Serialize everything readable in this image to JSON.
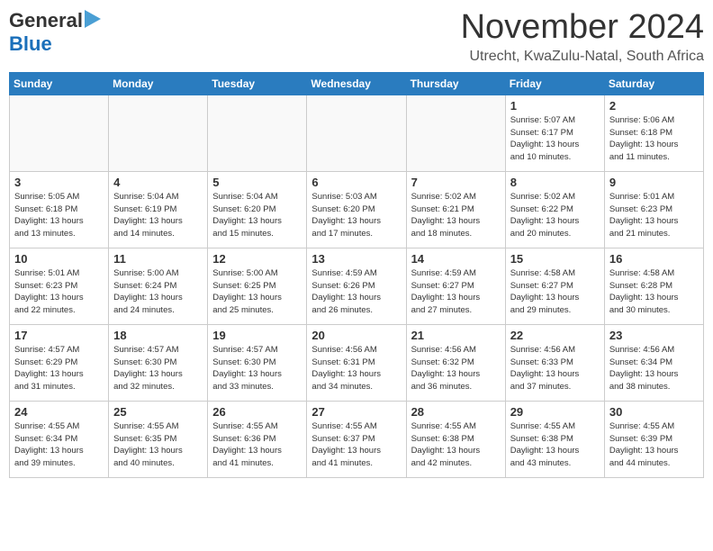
{
  "header": {
    "logo_general": "General",
    "logo_blue": "Blue",
    "month_title": "November 2024",
    "location": "Utrecht, KwaZulu-Natal, South Africa"
  },
  "days_of_week": [
    "Sunday",
    "Monday",
    "Tuesday",
    "Wednesday",
    "Thursday",
    "Friday",
    "Saturday"
  ],
  "weeks": [
    [
      {
        "day": "",
        "info": "",
        "empty": true
      },
      {
        "day": "",
        "info": "",
        "empty": true
      },
      {
        "day": "",
        "info": "",
        "empty": true
      },
      {
        "day": "",
        "info": "",
        "empty": true
      },
      {
        "day": "",
        "info": "",
        "empty": true
      },
      {
        "day": "1",
        "info": "Sunrise: 5:07 AM\nSunset: 6:17 PM\nDaylight: 13 hours\nand 10 minutes."
      },
      {
        "day": "2",
        "info": "Sunrise: 5:06 AM\nSunset: 6:18 PM\nDaylight: 13 hours\nand 11 minutes."
      }
    ],
    [
      {
        "day": "3",
        "info": "Sunrise: 5:05 AM\nSunset: 6:18 PM\nDaylight: 13 hours\nand 13 minutes."
      },
      {
        "day": "4",
        "info": "Sunrise: 5:04 AM\nSunset: 6:19 PM\nDaylight: 13 hours\nand 14 minutes."
      },
      {
        "day": "5",
        "info": "Sunrise: 5:04 AM\nSunset: 6:20 PM\nDaylight: 13 hours\nand 15 minutes."
      },
      {
        "day": "6",
        "info": "Sunrise: 5:03 AM\nSunset: 6:20 PM\nDaylight: 13 hours\nand 17 minutes."
      },
      {
        "day": "7",
        "info": "Sunrise: 5:02 AM\nSunset: 6:21 PM\nDaylight: 13 hours\nand 18 minutes."
      },
      {
        "day": "8",
        "info": "Sunrise: 5:02 AM\nSunset: 6:22 PM\nDaylight: 13 hours\nand 20 minutes."
      },
      {
        "day": "9",
        "info": "Sunrise: 5:01 AM\nSunset: 6:23 PM\nDaylight: 13 hours\nand 21 minutes."
      }
    ],
    [
      {
        "day": "10",
        "info": "Sunrise: 5:01 AM\nSunset: 6:23 PM\nDaylight: 13 hours\nand 22 minutes."
      },
      {
        "day": "11",
        "info": "Sunrise: 5:00 AM\nSunset: 6:24 PM\nDaylight: 13 hours\nand 24 minutes."
      },
      {
        "day": "12",
        "info": "Sunrise: 5:00 AM\nSunset: 6:25 PM\nDaylight: 13 hours\nand 25 minutes."
      },
      {
        "day": "13",
        "info": "Sunrise: 4:59 AM\nSunset: 6:26 PM\nDaylight: 13 hours\nand 26 minutes."
      },
      {
        "day": "14",
        "info": "Sunrise: 4:59 AM\nSunset: 6:27 PM\nDaylight: 13 hours\nand 27 minutes."
      },
      {
        "day": "15",
        "info": "Sunrise: 4:58 AM\nSunset: 6:27 PM\nDaylight: 13 hours\nand 29 minutes."
      },
      {
        "day": "16",
        "info": "Sunrise: 4:58 AM\nSunset: 6:28 PM\nDaylight: 13 hours\nand 30 minutes."
      }
    ],
    [
      {
        "day": "17",
        "info": "Sunrise: 4:57 AM\nSunset: 6:29 PM\nDaylight: 13 hours\nand 31 minutes."
      },
      {
        "day": "18",
        "info": "Sunrise: 4:57 AM\nSunset: 6:30 PM\nDaylight: 13 hours\nand 32 minutes."
      },
      {
        "day": "19",
        "info": "Sunrise: 4:57 AM\nSunset: 6:30 PM\nDaylight: 13 hours\nand 33 minutes."
      },
      {
        "day": "20",
        "info": "Sunrise: 4:56 AM\nSunset: 6:31 PM\nDaylight: 13 hours\nand 34 minutes."
      },
      {
        "day": "21",
        "info": "Sunrise: 4:56 AM\nSunset: 6:32 PM\nDaylight: 13 hours\nand 36 minutes."
      },
      {
        "day": "22",
        "info": "Sunrise: 4:56 AM\nSunset: 6:33 PM\nDaylight: 13 hours\nand 37 minutes."
      },
      {
        "day": "23",
        "info": "Sunrise: 4:56 AM\nSunset: 6:34 PM\nDaylight: 13 hours\nand 38 minutes."
      }
    ],
    [
      {
        "day": "24",
        "info": "Sunrise: 4:55 AM\nSunset: 6:34 PM\nDaylight: 13 hours\nand 39 minutes."
      },
      {
        "day": "25",
        "info": "Sunrise: 4:55 AM\nSunset: 6:35 PM\nDaylight: 13 hours\nand 40 minutes."
      },
      {
        "day": "26",
        "info": "Sunrise: 4:55 AM\nSunset: 6:36 PM\nDaylight: 13 hours\nand 41 minutes."
      },
      {
        "day": "27",
        "info": "Sunrise: 4:55 AM\nSunset: 6:37 PM\nDaylight: 13 hours\nand 41 minutes."
      },
      {
        "day": "28",
        "info": "Sunrise: 4:55 AM\nSunset: 6:38 PM\nDaylight: 13 hours\nand 42 minutes."
      },
      {
        "day": "29",
        "info": "Sunrise: 4:55 AM\nSunset: 6:38 PM\nDaylight: 13 hours\nand 43 minutes."
      },
      {
        "day": "30",
        "info": "Sunrise: 4:55 AM\nSunset: 6:39 PM\nDaylight: 13 hours\nand 44 minutes."
      }
    ]
  ]
}
